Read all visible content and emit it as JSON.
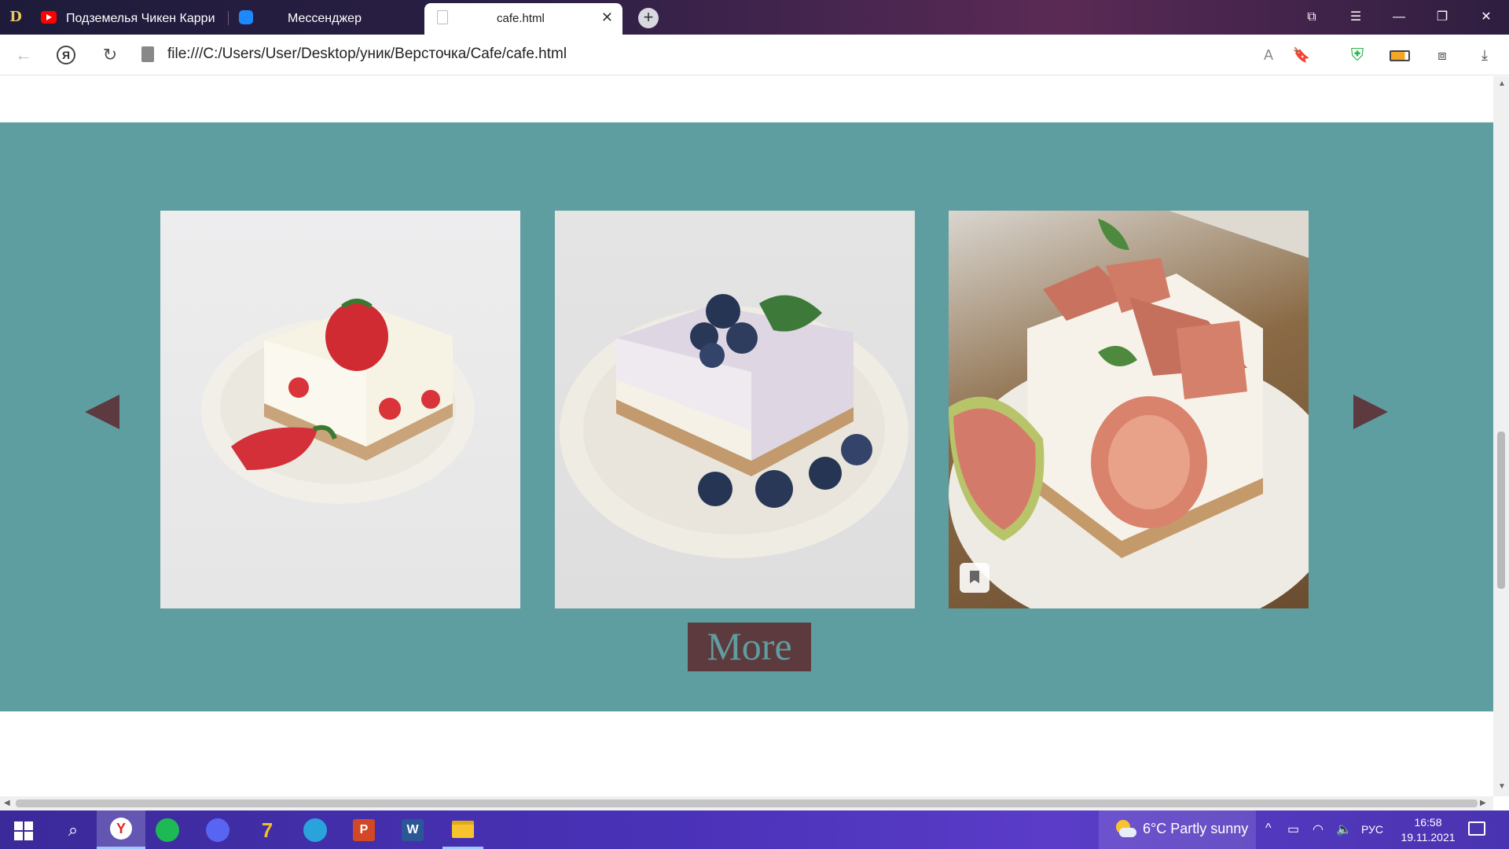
{
  "browser": {
    "brand_glyph": "D",
    "tabs": [
      {
        "label": "Подземелья Чикен Карри",
        "icon": "youtube-icon"
      },
      {
        "label": "Мессенджер",
        "icon": "messenger-icon"
      },
      {
        "label": "cafe.html",
        "icon": "file-icon",
        "active": true
      }
    ],
    "address": "file:///C:/Users/User/Desktop/уник/Версточка/Cafe/cafe.html"
  },
  "page": {
    "section_bg": "#5f9ea0",
    "accent": "#5c3a3d",
    "gallery": [
      {
        "alt": "strawberry-cheesecake"
      },
      {
        "alt": "blueberry-cheesecake"
      },
      {
        "alt": "fig-cheesecake"
      }
    ],
    "more_label": "More"
  },
  "taskbar": {
    "weather": "6°C  Partly sunny",
    "lang": "РУС",
    "time": "16:58",
    "date": "19.11.2021",
    "ya_glyph": "Y",
    "seven_glyph": "7",
    "ppt_glyph": "P",
    "word_glyph": "W"
  }
}
